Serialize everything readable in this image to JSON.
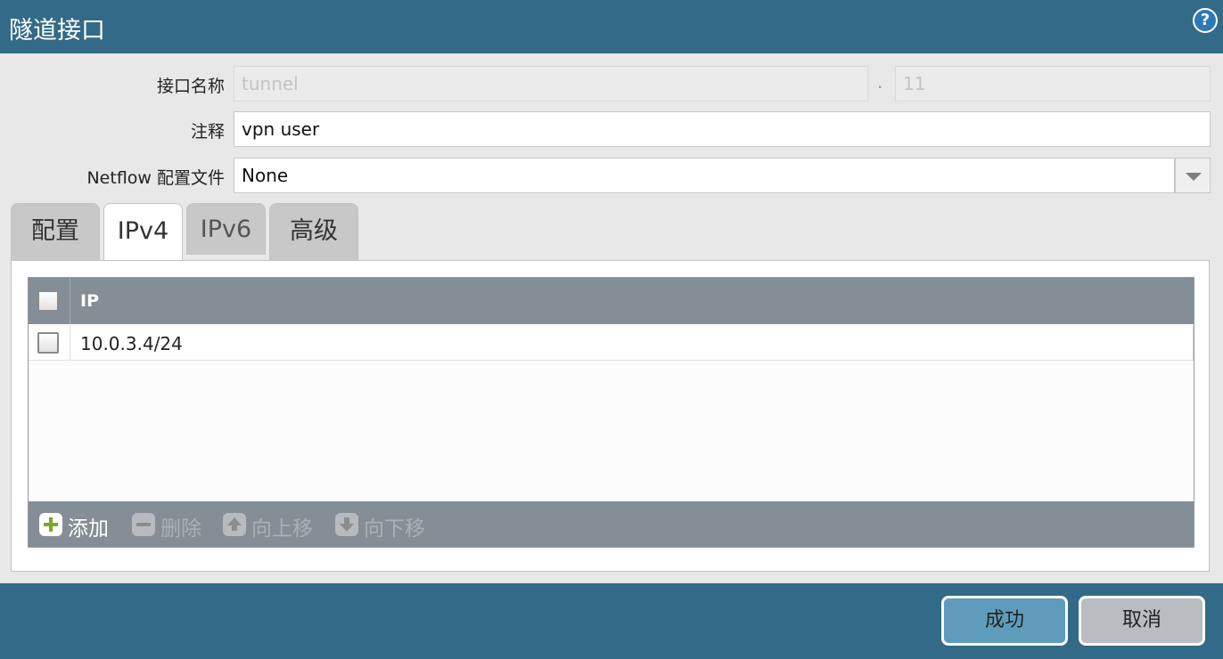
{
  "dialog": {
    "title": "隧道接口"
  },
  "form": {
    "interface_name": {
      "label": "接口名称",
      "value": "tunnel",
      "separator": ".",
      "suffix": "11"
    },
    "comment": {
      "label": "注释",
      "value": "vpn user"
    },
    "netflow": {
      "label": "Netflow 配置文件",
      "value": "None"
    }
  },
  "tabs": [
    {
      "label": "配置"
    },
    {
      "label": "IPv4"
    },
    {
      "label": "IPv6"
    },
    {
      "label": "高级"
    }
  ],
  "ip_table": {
    "header": "IP",
    "rows": [
      {
        "ip": "10.0.3.4/24"
      }
    ]
  },
  "toolbar": {
    "add": "添加",
    "delete": "删除",
    "move_up": "向上移",
    "move_down": "向下移"
  },
  "footer": {
    "ok": "成功",
    "cancel": "取消"
  },
  "colors": {
    "header_bg": "#336a87",
    "grid_header_bg": "#858e96",
    "ok_button": "#5f9cbb",
    "cancel_button": "#b9bcc1"
  },
  "icons": {
    "help": "help-icon",
    "add": "add-icon",
    "delete": "delete-icon",
    "move_up": "move-up-icon",
    "move_down": "move-down-icon",
    "dropdown": "chevron-down-icon"
  }
}
